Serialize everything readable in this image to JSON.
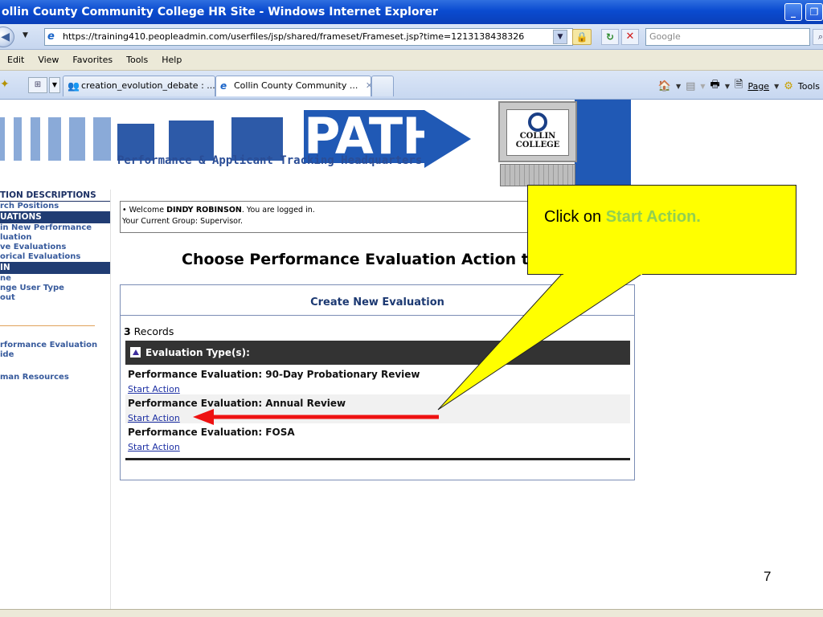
{
  "window": {
    "title": "ollin County Community College HR Site - Windows Internet Explorer"
  },
  "address_bar": {
    "url": "https://training410.peopleadmin.com/userfiles/jsp/shared/frameset/Frameset.jsp?time=1213138438326",
    "search_placeholder": "Google"
  },
  "menu": {
    "items": [
      "Edit",
      "View",
      "Favorites",
      "Tools",
      "Help"
    ]
  },
  "tabs": [
    {
      "label": "creation_evolution_debate : ..."
    },
    {
      "label": "Collin County Community ...",
      "close": "✕"
    }
  ],
  "command_bar": {
    "page_label": "Page",
    "tools_label": "Tools"
  },
  "banner": {
    "path_word": "PATH",
    "tagline": "Performance & Applicant Tracking Headquarters",
    "college_line1": "COLLIN",
    "college_line2": "COLLEGE"
  },
  "left_nav": {
    "section1_header": "TION DESCRIPTIONS",
    "section1_links": [
      "rch Positions"
    ],
    "section2_header": "UATIONS",
    "section2_links": [
      "in New Performance",
      "luation",
      "ve Evaluations",
      "orical Evaluations"
    ],
    "section3_header": "IN",
    "section3_links": [
      "ne",
      "nge User Type",
      "out"
    ],
    "extra_links": [
      "rformance Evaluation",
      "ide",
      "man Resources"
    ]
  },
  "welcome": {
    "prefix": "• Welcome ",
    "user": "DINDY ROBINSON",
    "suffix": ". You are logged in.",
    "group": "Your Current Group: Supervisor."
  },
  "main": {
    "heading": "Choose Performance Evaluation Action to",
    "panel_title": "Create New Evaluation",
    "record_count": "3",
    "records_label": " Records",
    "type_header": "Evaluation Type(s):",
    "rows": [
      {
        "title": "Performance Evaluation: 90-Day Probationary Review",
        "action": "Start Action"
      },
      {
        "title": "Performance Evaluation: Annual Review",
        "action": "Start Action"
      },
      {
        "title": "Performance Evaluation: FOSA",
        "action": "Start Action"
      }
    ]
  },
  "callout": {
    "prefix": "Click on ",
    "highlight": "Start Action.",
    "fill_color": "#ffff00",
    "highlight_color": "#92d050"
  },
  "arrow_color": "#ee1111",
  "slide_number": "7"
}
